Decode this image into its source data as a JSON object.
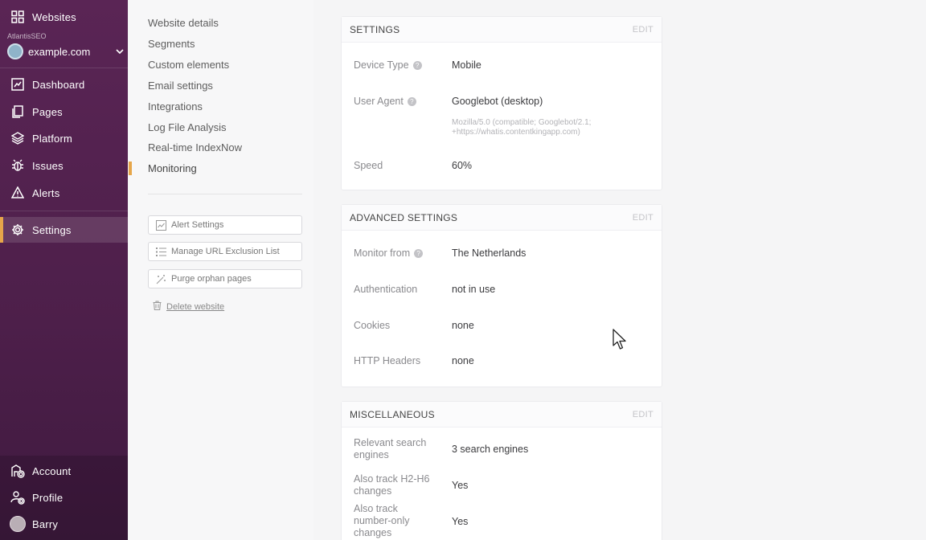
{
  "sidebar": {
    "websites_label": "Websites",
    "org_label": "AtlantisSEO",
    "site_name": "example.com",
    "nav": [
      {
        "label": "Dashboard",
        "icon": "dashboard-icon"
      },
      {
        "label": "Pages",
        "icon": "pages-icon"
      },
      {
        "label": "Platform",
        "icon": "platform-icon"
      },
      {
        "label": "Issues",
        "icon": "bug-icon"
      },
      {
        "label": "Alerts",
        "icon": "warning-icon"
      }
    ],
    "settings_label": "Settings",
    "bottom": [
      {
        "label": "Account",
        "icon": "account-gear-icon"
      },
      {
        "label": "Profile",
        "icon": "profile-gear-icon"
      },
      {
        "label": "Barry",
        "icon": "avatar"
      }
    ]
  },
  "subnav": {
    "items": [
      "Website details",
      "Segments",
      "Custom elements",
      "Email settings",
      "Integrations",
      "Log File Analysis",
      "Real-time IndexNow",
      "Monitoring"
    ],
    "active": "Monitoring",
    "buttons": {
      "alert_settings": "Alert Settings",
      "manage_exclusion": "Manage URL Exclusion List",
      "purge_orphan": "Purge orphan pages"
    },
    "delete_label": "Delete website"
  },
  "settings_card": {
    "title": "SETTINGS",
    "edit": "EDIT",
    "device_type_label": "Device Type",
    "device_type_value": "Mobile",
    "user_agent_label": "User Agent",
    "user_agent_value": "Googlebot (desktop)",
    "user_agent_string": "Mozilla/5.0 (compatible; Googlebot/2.1; +https://whatis.contentkingapp.com)",
    "speed_label": "Speed",
    "speed_value": "60%"
  },
  "advanced_card": {
    "title": "ADVANCED SETTINGS",
    "edit": "EDIT",
    "monitor_from_label": "Monitor from",
    "monitor_from_value": "The Netherlands",
    "authentication_label": "Authentication",
    "authentication_value": "not in use",
    "cookies_label": "Cookies",
    "cookies_value": "none",
    "http_headers_label": "HTTP Headers",
    "http_headers_value": "none"
  },
  "misc_card": {
    "title": "MISCELLANEOUS",
    "edit": "EDIT",
    "search_engines_label": "Relevant search engines",
    "search_engines_value": "3 search engines",
    "h2h6_label": "Also track H2-H6 changes",
    "h2h6_value": "Yes",
    "number_only_label": "Also track number-only changes",
    "number_only_value": "Yes"
  },
  "colors": {
    "sidebar_bg": "#5a2555",
    "accent": "#e6a64a"
  }
}
